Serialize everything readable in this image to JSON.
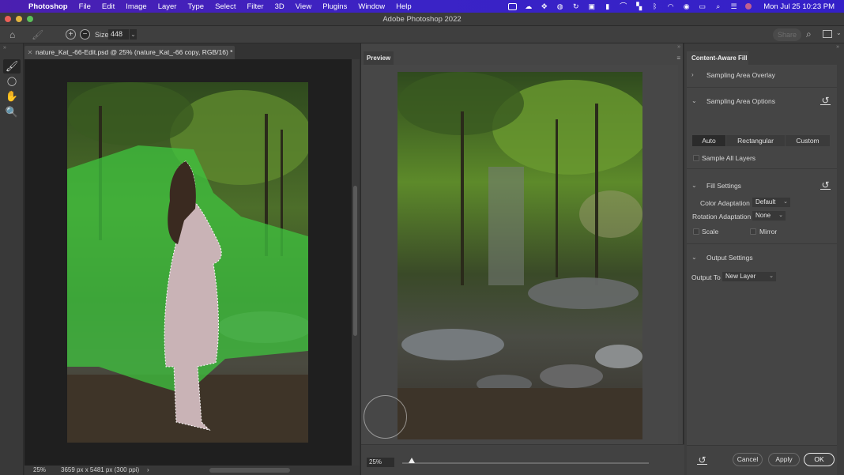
{
  "menubar": {
    "app_name": "Photoshop",
    "items": [
      "File",
      "Edit",
      "Image",
      "Layer",
      "Type",
      "Select",
      "Filter",
      "3D",
      "View",
      "Plugins",
      "Window",
      "Help"
    ],
    "tray_icons": [
      "screen-record-icon",
      "creative-cloud-icon",
      "dropbox-icon",
      "globe-icon",
      "sync-icon",
      "cast-icon",
      "bookmark-icon",
      "arc-icon",
      "grid-icon",
      "bluetooth-icon",
      "wifi-icon",
      "user-icon",
      "battery-icon",
      "spotlight-icon",
      "control-center-icon",
      "siri-icon"
    ],
    "clock": "Mon Jul 25  10:23 PM"
  },
  "titlebar": {
    "title": "Adobe Photoshop 2022"
  },
  "options_bar": {
    "size_label": "Size",
    "size_value": "448",
    "share_label": "Share"
  },
  "toolbar": {
    "tools": [
      {
        "name": "sampling-brush-tool",
        "glyph": "🖌",
        "active": true
      },
      {
        "name": "lasso-tool",
        "glyph": "◯",
        "active": false
      },
      {
        "name": "hand-tool",
        "glyph": "✋",
        "active": false
      },
      {
        "name": "zoom-tool",
        "glyph": "🔍",
        "active": false
      }
    ]
  },
  "document": {
    "tab_title": "nature_Kat_-66-Edit.psd @ 25% (nature_Kat_-66 copy, RGB/16) *",
    "zoom": "25%",
    "dimensions": "3659 px x 5481 px (300 ppi)"
  },
  "preview": {
    "tab_label": "Preview",
    "zoom_value": "25%",
    "zoom_slider_percent": 4
  },
  "content_aware_fill": {
    "panel_title": "Content-Aware Fill",
    "sampling_area_overlay": {
      "label": "Sampling Area Overlay",
      "expanded": false
    },
    "sampling_area_options": {
      "label": "Sampling Area Options",
      "expanded": true,
      "modes": [
        "Auto",
        "Rectangular",
        "Custom"
      ],
      "selected_mode": "Auto",
      "sample_all_layers_label": "Sample All Layers",
      "sample_all_layers": false
    },
    "fill_settings": {
      "label": "Fill Settings",
      "expanded": true,
      "color_adaptation_label": "Color Adaptation",
      "color_adaptation_value": "Default",
      "rotation_adaptation_label": "Rotation Adaptation",
      "rotation_adaptation_value": "None",
      "scale_label": "Scale",
      "scale": false,
      "mirror_label": "Mirror",
      "mirror": false
    },
    "output_settings": {
      "label": "Output Settings",
      "expanded": true,
      "output_to_label": "Output To",
      "output_to_value": "New Layer"
    },
    "footer": {
      "cancel_label": "Cancel",
      "apply_label": "Apply",
      "ok_label": "OK"
    }
  },
  "colors": {
    "menubar_gradient_start": "#4b1fb0",
    "menubar_gradient_end": "#3420c8",
    "sampling_overlay_green": "#3fc43f",
    "ui_dark": "#323232"
  }
}
